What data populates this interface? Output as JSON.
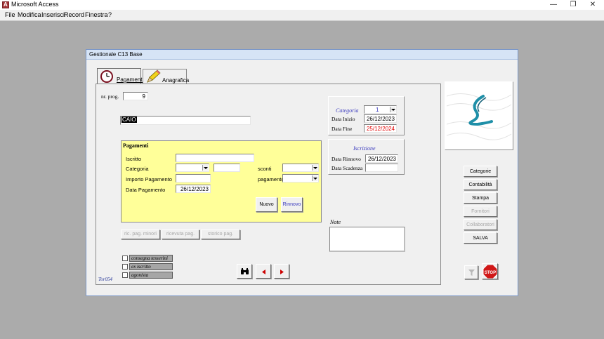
{
  "app": {
    "title": "Microsoft Access",
    "menu": [
      "File",
      "Modifica",
      "Inserisci",
      "Record",
      "Finestra",
      "?"
    ]
  },
  "form": {
    "title": "Gestionale C13 Base",
    "tabs": [
      {
        "label": "Pagamenti",
        "selected": true
      },
      {
        "label": "Anagrafica",
        "selected": false
      }
    ],
    "nr_prog": {
      "label": "nr. prog.",
      "value": "9"
    },
    "name_value": "CAIO",
    "payments": {
      "title": "Pagamenti",
      "iscritto_label": "Iscritto",
      "iscritto_value": "",
      "categoria_label": "Categoria",
      "categoria_value": "",
      "sconti_label": "sconti",
      "sconti_value": "",
      "importo_label": "Importo Pagamento",
      "importo_value": "",
      "pagamento_label": "pagamento",
      "pagamento_value": "",
      "data_label": "Data Pagamento",
      "data_value": "26/12/2023",
      "nuovo_label": "Nuovo",
      "rinnovo_label": "Rinnovo"
    },
    "sub_buttons": [
      "ric. pag. minori",
      "ricevuta pag.",
      "storico pag."
    ],
    "checkboxes": [
      "consegna tesserini",
      "ex iscritto",
      "agonista"
    ],
    "footer_code": "Tor054",
    "categoria_box": {
      "title": "Categoria",
      "value": "1",
      "data_inizio_label": "Data Inizio",
      "data_inizio": "26/12/2023",
      "data_fine_label": "Data Fine",
      "data_fine": "25/12/2024",
      "data_fine_color": "#e00000"
    },
    "iscrizione_box": {
      "title": "Iscrizione",
      "data_rinnovo_label": "Data Rinnovo",
      "data_rinnovo": "26/12/2023",
      "data_scadenza_label": "Data Scadenza",
      "data_scadenza": ""
    },
    "note": {
      "label": "Note",
      "value": ""
    },
    "side_buttons": [
      {
        "label": "Categorie",
        "enabled": true
      },
      {
        "label": "Contabilità",
        "enabled": true
      },
      {
        "label": "Stampa",
        "enabled": true
      },
      {
        "label": "Fornitori",
        "enabled": false
      },
      {
        "label": "Collaboratori",
        "enabled": false
      },
      {
        "label": "SALVA",
        "enabled": true
      }
    ],
    "stop_label": "STOP",
    "accent_yellow": "#ffff99",
    "stop_color": "#d01818"
  }
}
